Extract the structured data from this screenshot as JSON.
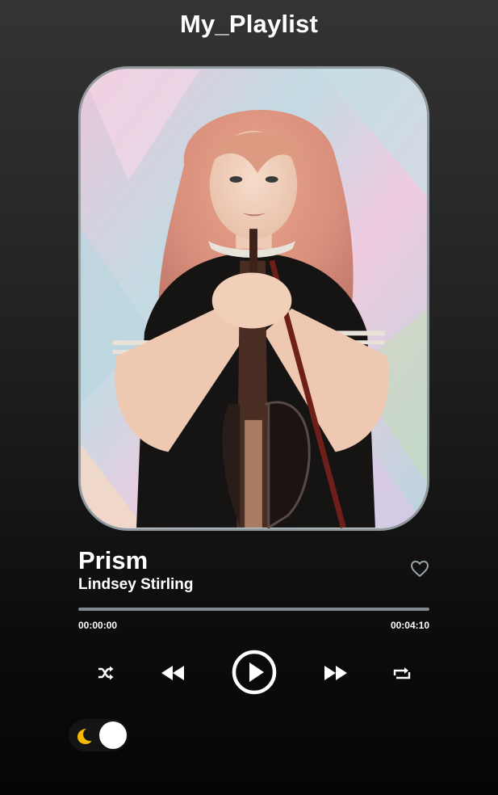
{
  "app": {
    "title": "My_Playlist"
  },
  "now_playing": {
    "title": "Prism",
    "artist": "Lindsey Stirling",
    "cover_icon": "album-cover-image",
    "liked": false
  },
  "progress": {
    "current_time": "00:00:00",
    "total_time": "00:04:10",
    "fraction": 0
  },
  "controls": [
    {
      "id": "shuffle",
      "icon": "shuffle-icon"
    },
    {
      "id": "previous",
      "icon": "rewind-icon"
    },
    {
      "id": "play",
      "icon": "play-circle-icon"
    },
    {
      "id": "next",
      "icon": "fast-forward-icon"
    },
    {
      "id": "repeat",
      "icon": "repeat-icon"
    }
  ],
  "theme": {
    "mode": "dark",
    "icon": "moon-icon",
    "accent": "#f5b800"
  },
  "colors": {
    "background_top": "#343434",
    "background_bottom": "#050505",
    "progress_track": "#7f8a8e",
    "text": "#ffffff"
  }
}
